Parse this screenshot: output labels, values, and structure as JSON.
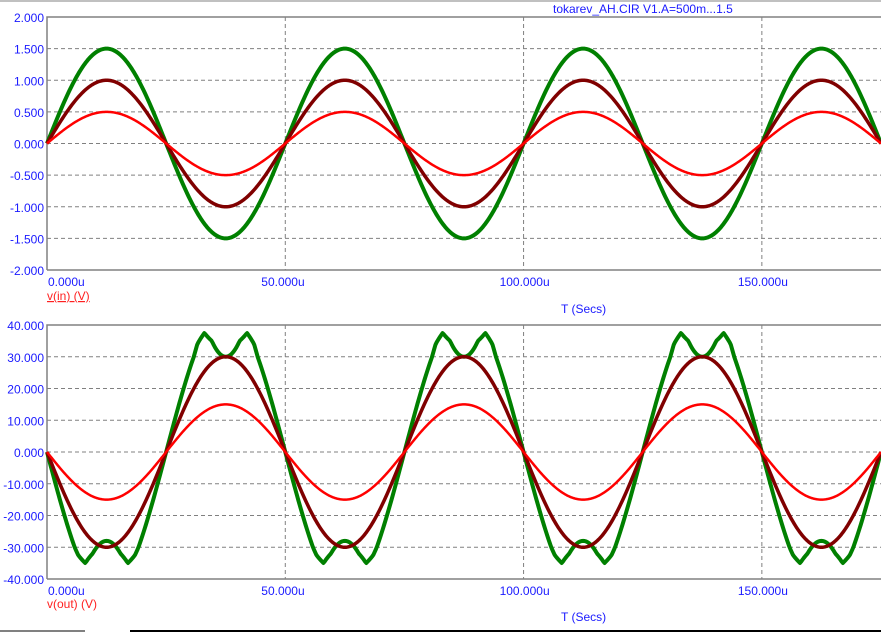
{
  "title": "tokarev_AH.CIR V1.A=500m...1.5",
  "colors": {
    "axis_text": "#1a1aff",
    "grid": "#808080",
    "frame": "#808080",
    "legend": "#ff2020"
  },
  "chart_data": [
    {
      "type": "line",
      "name": "top",
      "ylabel_legend": "v(in) (V)",
      "xlabel": "T (Secs)",
      "xlim": [
        0,
        175
      ],
      "ylim": [
        -2,
        2
      ],
      "x_ticks": [
        0,
        50,
        100,
        150
      ],
      "x_tick_labels": [
        "0.000u",
        "50.000u",
        "100.000u",
        "150.000u"
      ],
      "y_ticks": [
        2,
        1.5,
        1,
        0.5,
        0,
        -0.5,
        -1,
        -1.5,
        -2
      ],
      "y_tick_labels": [
        "2.000",
        "1.500",
        "1.000",
        "0.500",
        "0.000",
        "-0.500",
        "-1.000",
        "-1.500",
        "-2.000"
      ],
      "grid": true,
      "period_us": 50,
      "series": [
        {
          "name": "V1.A=0.5",
          "amplitude": 0.5,
          "color": "#ff0000"
        },
        {
          "name": "V1.A=1",
          "amplitude": 1.0,
          "color": "#800000"
        },
        {
          "name": "V1.A=1.5",
          "amplitude": 1.5,
          "color": "#008000"
        }
      ]
    },
    {
      "type": "line",
      "name": "bottom",
      "ylabel_legend": "v(out) (V)",
      "xlabel": "T (Secs)",
      "xlim": [
        0,
        175
      ],
      "ylim": [
        -40,
        40
      ],
      "x_ticks": [
        0,
        50,
        100,
        150
      ],
      "x_tick_labels": [
        "0.000u",
        "50.000u",
        "100.000u",
        "150.000u"
      ],
      "y_ticks": [
        40,
        30,
        20,
        10,
        0,
        -10,
        -20,
        -30,
        -40
      ],
      "y_tick_labels": [
        "40.000",
        "30.000",
        "20.000",
        "10.000",
        "0.000",
        "-10.000",
        "-20.000",
        "-30.000",
        "-40.000"
      ],
      "grid": true,
      "period_us": 50,
      "transfer_in": [
        -1.5,
        -1.4,
        -1.27,
        -1.1,
        -1.0,
        -0.5,
        0,
        0.5,
        1.0,
        1.1,
        1.27,
        1.4,
        1.5
      ],
      "transfer_out": [
        30,
        35,
        37.5,
        34,
        30,
        15,
        0,
        -15,
        -30,
        -32.5,
        -35,
        -32,
        -28
      ],
      "series": [
        {
          "name": "V1.A=0.5",
          "amplitude": 0.5,
          "color": "#ff0000"
        },
        {
          "name": "V1.A=1",
          "amplitude": 1.0,
          "color": "#800000"
        },
        {
          "name": "V1.A=1.5",
          "amplitude": 1.5,
          "color": "#008000"
        }
      ]
    }
  ]
}
